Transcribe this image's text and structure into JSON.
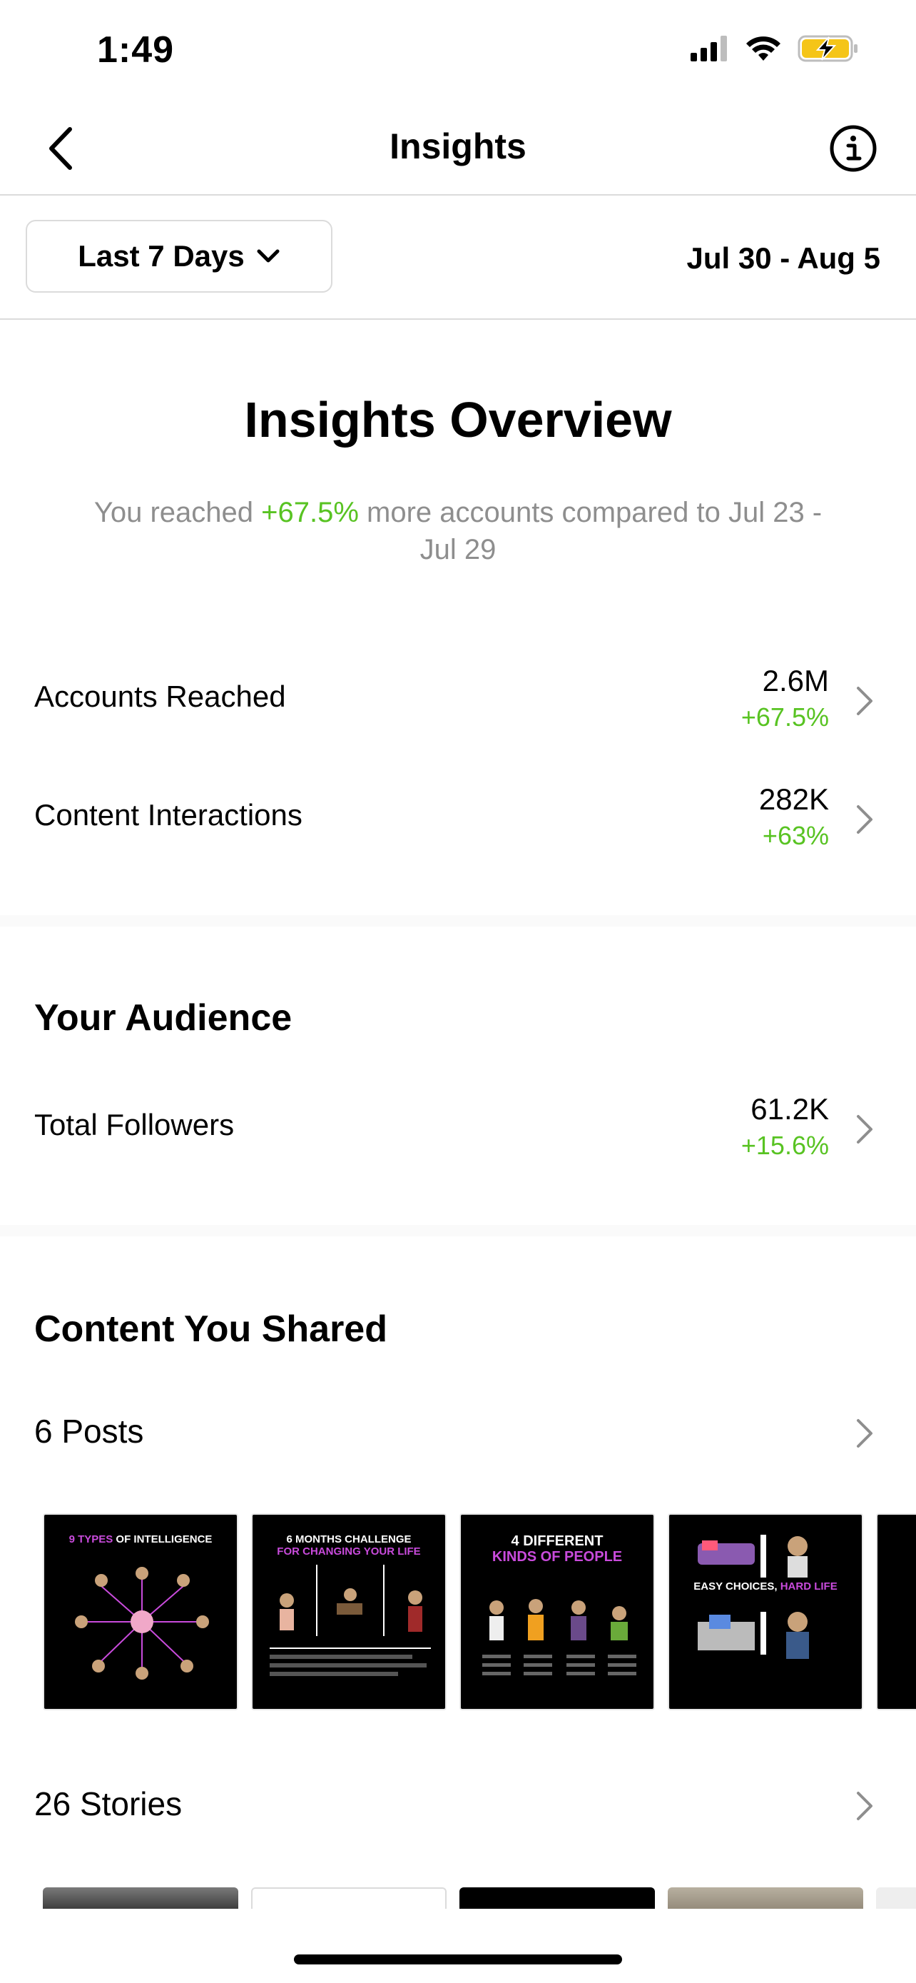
{
  "status_bar": {
    "time": "1:49"
  },
  "header": {
    "title": "Insights"
  },
  "filter": {
    "range_label": "Last 7 Days",
    "date_range": "Jul 30 - Aug 5"
  },
  "overview": {
    "title": "Insights Overview",
    "subtitle_pre": "You reached ",
    "subtitle_highlight": "+67.5%",
    "subtitle_post": " more accounts compared to Jul 23 - Jul 29",
    "metrics": [
      {
        "label": "Accounts Reached",
        "value": "2.6M",
        "change": "+67.5%"
      },
      {
        "label": "Content Interactions",
        "value": "282K",
        "change": "+63%"
      }
    ]
  },
  "audience": {
    "title": "Your Audience",
    "metrics": [
      {
        "label": "Total Followers",
        "value": "61.2K",
        "change": "+15.6%"
      }
    ]
  },
  "content": {
    "title": "Content You Shared",
    "posts_label": "6 Posts",
    "stories_label": "26 Stories",
    "posts": [
      {
        "title_highlight": "9 TYPES",
        "title_rest": " OF INTELLIGENCE"
      },
      {
        "title_rest": "6 MONTHS CHALLENGE",
        "title_highlight": "FOR CHANGING YOUR LIFE"
      },
      {
        "title_rest": "4 DIFFERENT",
        "title_highlight": "KINDS OF PEOPLE"
      },
      {
        "title_rest": "EASY CHOICES,",
        "title_highlight": "HARD LIFE"
      }
    ]
  },
  "colors": {
    "positive": "#58c322",
    "accent_pink": "#c94bdc",
    "divider": "#dbdbdb"
  }
}
